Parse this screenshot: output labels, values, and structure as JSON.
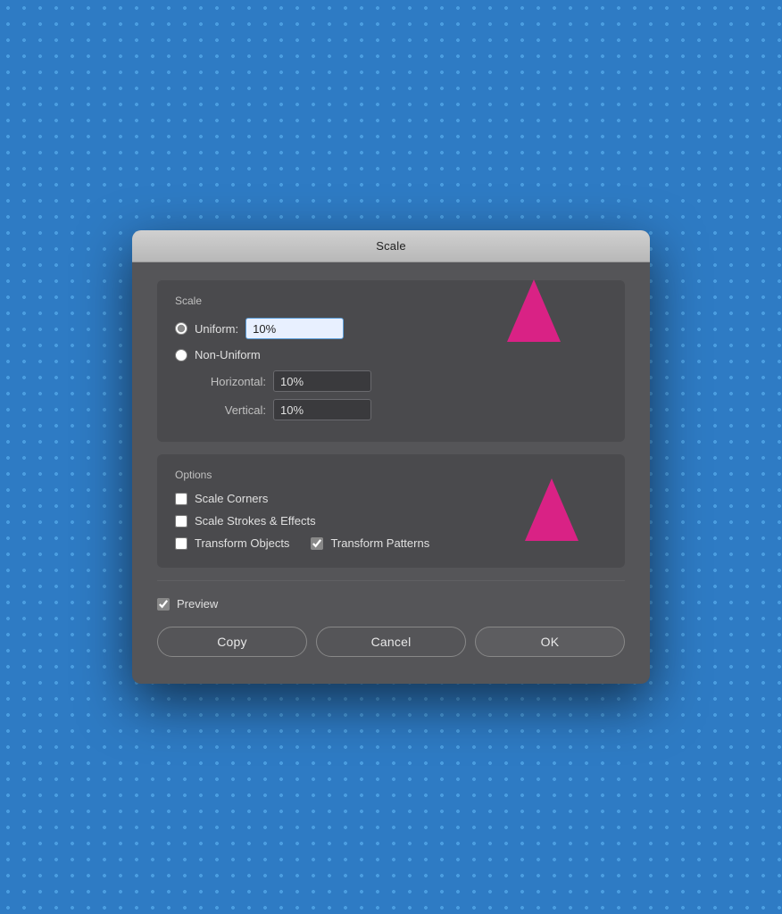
{
  "dialog": {
    "title": "Scale",
    "scale_section_label": "Scale",
    "uniform_label": "Uniform:",
    "uniform_value": "10%",
    "nonuniform_label": "Non-Uniform",
    "horizontal_label": "Horizontal:",
    "horizontal_value": "10%",
    "vertical_label": "Vertical:",
    "vertical_value": "10%",
    "options_section_label": "Options",
    "scale_corners_label": "Scale Corners",
    "scale_strokes_label": "Scale Strokes & Effects",
    "transform_objects_label": "Transform Objects",
    "transform_patterns_label": "Transform Patterns",
    "preview_label": "Preview",
    "copy_button": "Copy",
    "cancel_button": "Cancel",
    "ok_button": "OK"
  },
  "state": {
    "uniform_checked": true,
    "nonuniform_checked": false,
    "scale_corners_checked": false,
    "scale_strokes_checked": false,
    "transform_objects_checked": false,
    "transform_patterns_checked": true,
    "preview_checked": true
  }
}
